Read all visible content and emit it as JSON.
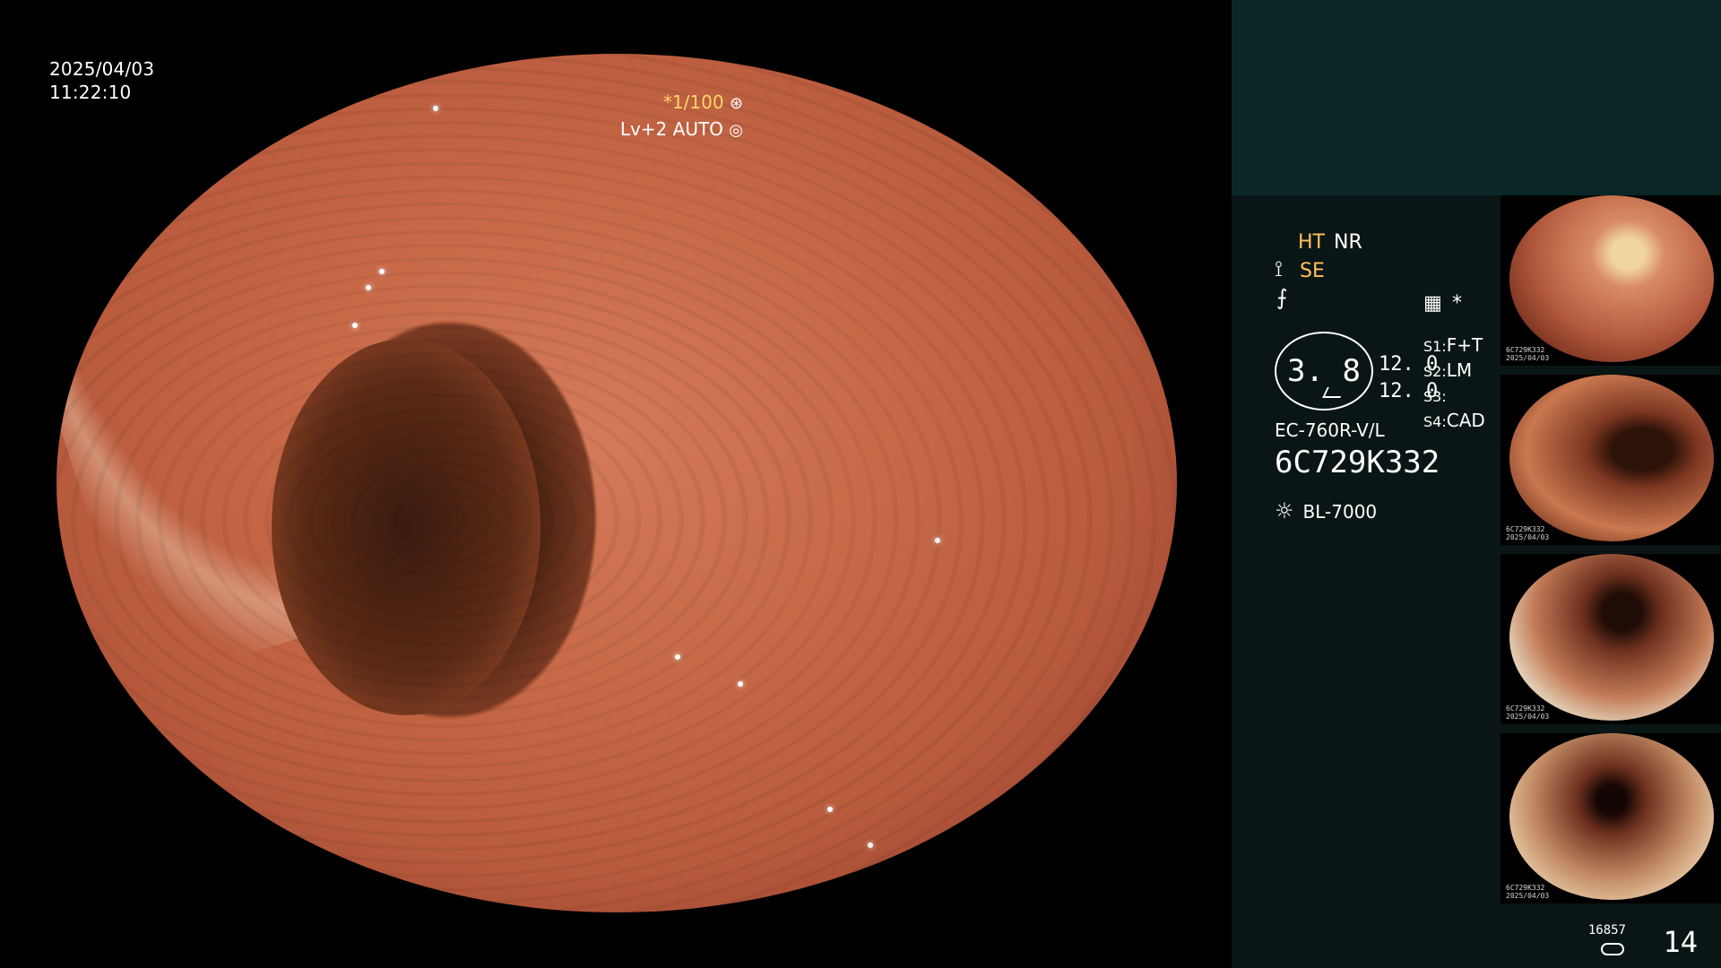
{
  "overlay": {
    "date": "2025/04/03",
    "time": "11:22:10",
    "shutter_prefix": "*",
    "shutter": "1/100",
    "shutter_icon": "aperture-icon",
    "level": "Lv+2",
    "auto": "AUTO",
    "auto_icon": "target-icon"
  },
  "panel": {
    "ht": "HT",
    "nr": "NR",
    "se": "SE",
    "se_icon": "se-mode-icon",
    "f_icon": "f-mode-icon",
    "cfg_icon": "settings-icon",
    "star": "*",
    "circle_value": "3. 8",
    "num1": "12. 0",
    "num2": "12. 0",
    "s1": "S1:",
    "s1v": "F+T",
    "s2": "S2:",
    "s2v": "LM",
    "s3": "S3:",
    "s3v": "",
    "s4": "S4:",
    "s4v": "CAD",
    "model": "EC-760R-V/L",
    "serial": "6C729K332",
    "light_icon": "light-source-icon",
    "light": "BL-7000",
    "counter_small": "16857",
    "counter_big": "14",
    "drum_icon": "storage-drum-icon"
  },
  "thumbnails": [
    {
      "top": "6C729K332",
      "bottom": "2025/04/03"
    },
    {
      "top": "6C729K332",
      "bottom": "2025/04/03"
    },
    {
      "top": "6C729K332",
      "bottom": "2025/04/03"
    },
    {
      "top": "6C729K332",
      "bottom": "2025/04/03"
    }
  ]
}
